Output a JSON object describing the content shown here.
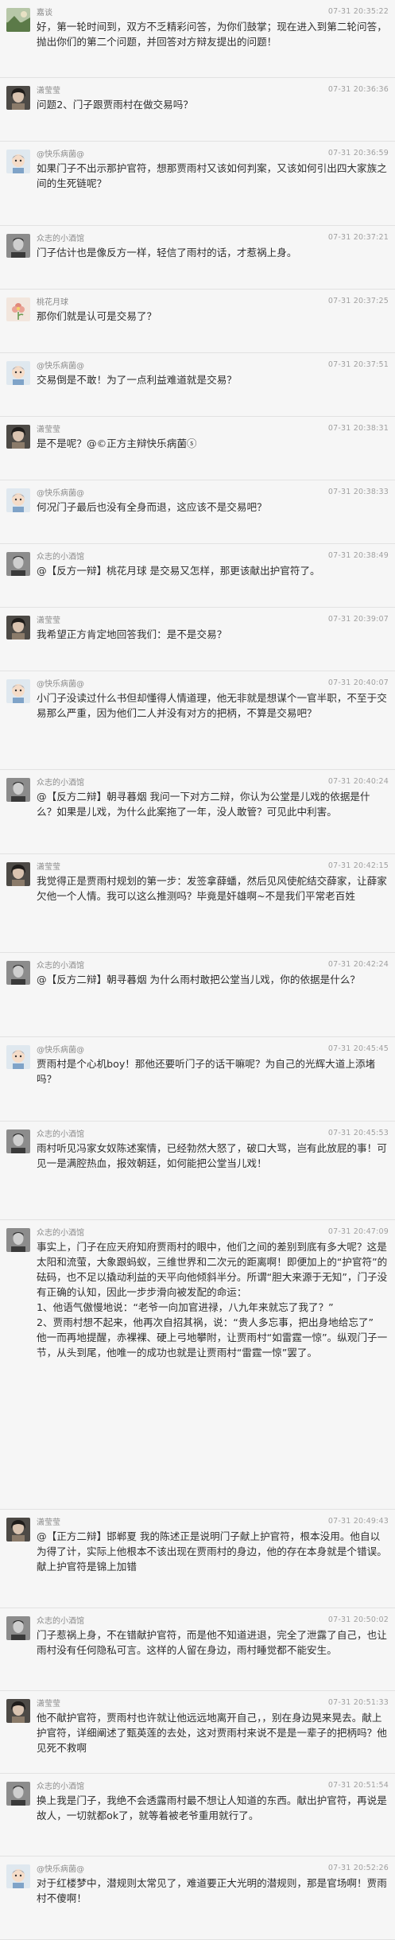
{
  "messages": [
    {
      "name": "嘉谈",
      "time": "07-31 20:35:22",
      "avatar": "avatar-scenery",
      "text": "好，第一轮时间到，双方不乏精彩问答，为你们鼓掌；现在进入到第二轮问答，抛出你们的第二个问题，并回答对方辩友提出的问题！"
    },
    {
      "name": "潇莹莹",
      "time": "07-31 20:36:36",
      "avatar": "avatar-girl",
      "text": "问题2、门子跟贾雨村在做交易吗？"
    },
    {
      "name": "@快乐病菌@",
      "time": "07-31 20:36:59",
      "avatar": "avatar-cartoon",
      "text": "如果门子不出示那护官符，想那贾雨村又该如何判案，又该如何引出四大家族之间的生死链呢？"
    },
    {
      "name": "众志的小酒馆",
      "time": "07-31 20:37:21",
      "avatar": "avatar-man",
      "text": "门子估计也是像反方一样，轻信了雨村的话，才惹祸上身。"
    },
    {
      "name": "桃花月球",
      "time": "07-31 20:37:25",
      "avatar": "avatar-flower",
      "text": "那你们就是认可是交易了？"
    },
    {
      "name": "@快乐病菌@",
      "time": "07-31 20:37:51",
      "avatar": "avatar-cartoon",
      "text": "交易倒是不敢！为了一点利益难道就是交易？"
    },
    {
      "name": "潇莹莹",
      "time": "07-31 20:38:31",
      "avatar": "avatar-girl",
      "text": "是不是呢？@©正方主辩快乐病菌ⓢ"
    },
    {
      "name": "@快乐病菌@",
      "time": "07-31 20:38:33",
      "avatar": "avatar-cartoon",
      "text": "何况门子最后也没有全身而退，这应该不是交易吧？"
    },
    {
      "name": "众志的小酒馆",
      "time": "07-31 20:38:49",
      "avatar": "avatar-man",
      "text": "@【反方一辩】桃花月球 是交易又怎样，那更该献出护官符了。"
    },
    {
      "name": "潇莹莹",
      "time": "07-31 20:39:07",
      "avatar": "avatar-girl",
      "text": "我希望正方肯定地回答我们：是不是交易？"
    },
    {
      "name": "@快乐病菌@",
      "time": "07-31 20:40:07",
      "avatar": "avatar-cartoon",
      "text": "小门子没读过什么书但却懂得人情道理，他无非就是想谋个一官半职，不至于交易那么严重，因为他们二人并没有对方的把柄，不算是交易吧？"
    },
    {
      "name": "众志的小酒馆",
      "time": "07-31 20:40:24",
      "avatar": "avatar-man",
      "text": "@【反方二辩】朝寻暮烟 我问一下对方二辩，你认为公堂是儿戏的依据是什么？如果是儿戏，为什么此案拖了一年，没人敢管？可见此中利害。"
    },
    {
      "name": "潇莹莹",
      "time": "07-31 20:42:15",
      "avatar": "avatar-girl",
      "text": "我觉得正是贾雨村规划的第一步：发签拿薛蟠，然后见风使舵结交薛家，让薛家欠他一个人情。我可以这么推测吗？毕竟是奸雄啊~不是我们平常老百姓"
    },
    {
      "name": "众志的小酒馆",
      "time": "07-31 20:42:24",
      "avatar": "avatar-man",
      "text": "@【反方二辩】朝寻暮烟 为什么雨村敢把公堂当儿戏，你的依据是什么？"
    },
    {
      "name": "@快乐病菌@",
      "time": "07-31 20:45:45",
      "avatar": "avatar-cartoon",
      "text": "贾雨村是个心机boy！那他还要听门子的话干嘛呢？为自己的光辉大道上添堵吗？"
    },
    {
      "name": "众志的小酒馆",
      "time": "07-31 20:45:53",
      "avatar": "avatar-man",
      "text": "雨村听见冯家女奴陈述案情，已经勃然大怒了，破口大骂，岂有此放屁的事！可见一是满腔热血，报效朝廷，如何能把公堂当儿戏！"
    },
    {
      "name": "众志的小酒馆",
      "time": "07-31 20:47:09",
      "avatar": "avatar-man",
      "text": "事实上，门子在应天府知府贾雨村的眼中，他们之间的差别到底有多大呢？这是太阳和流萤，大象跟蚂蚁，三维世界和二次元的距离啊！即便加上的“护官符”的砝码，也不足以撬动利益的天平向他倾斜半分。所谓“胆大来源于无知”，门子没有正确的认知，因此一步步滑向被发配的命运：\n1、他语气傲慢地说：“老爷一向加官进禄，八九年来就忘了我了？”\n2、贾雨村想不起来，他再次自招其祸，说：“贵人多忘事，把出身地给忘了”\n他一而再地提醒，赤裸裸、硬上弓地攀附，让贾雨村“如雷霆一惊”。纵观门子一节，从头到尾，他唯一的成功也就是让贾雨村“雷霆一惊”罢了。"
    },
    {
      "name": "潇莹莹",
      "time": "07-31 20:49:43",
      "avatar": "avatar-girl",
      "text": "@【正方二辩】邯郸夏 我的陈述正是说明门子献上护官符，根本没用。他自以为得了计，实际上他根本不该出现在贾雨村的身边，他的存在本身就是个错误。献上护官符是锦上加错"
    },
    {
      "name": "众志的小酒馆",
      "time": "07-31 20:50:02",
      "avatar": "avatar-man",
      "text": "门子惹祸上身，不在错献护官符，而是他不知道进退，完全了泄露了自己，也让雨村没有任何隐私可言。这样的人留在身边，雨村睡觉都不能安生。"
    },
    {
      "name": "潇莹莹",
      "time": "07-31 20:51:33",
      "avatar": "avatar-girl",
      "text": "他不献护官符，贾雨村也许就让他远远地离开自己，，别在身边晃来晃去。献上护官符，详细阐述了甄英莲的去处，这对贾雨村来说不是是一辈子的把柄吗？他见死不救啊"
    },
    {
      "name": "众志的小酒馆",
      "time": "07-31 20:51:54",
      "avatar": "avatar-man",
      "text": "换上我是门子，我绝不会透露雨村最不想让人知道的东西。献出护官符，再说是故人，一切就都ok了，就等着被老爷重用就行了。"
    },
    {
      "name": "@快乐病菌@",
      "time": "07-31 20:52:26",
      "avatar": "avatar-cartoon",
      "text": "对于红楼梦中，潜规则太常见了，难道要正大光明的潜规则，那是官场啊！贾雨村不傻啊！"
    }
  ],
  "colors": {
    "background": "#f6f6f6",
    "divider": "#e2e2e2",
    "name": "#8a8a8a",
    "time": "#a0a0a0",
    "text": "#2e2e2e"
  }
}
